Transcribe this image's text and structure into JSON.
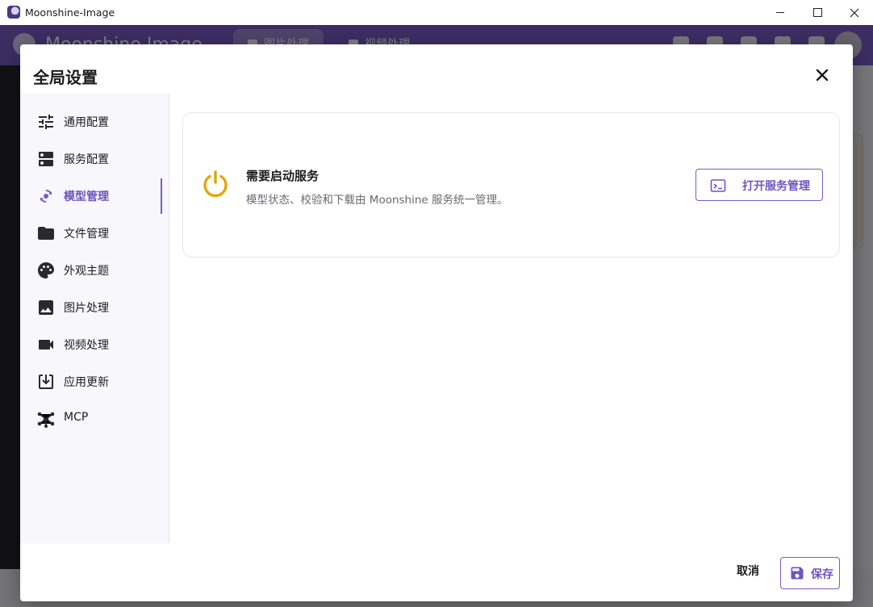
{
  "window": {
    "title": "Moonshine-Image"
  },
  "background_app": {
    "name": "Moonshine Image",
    "tabs": [
      {
        "label": "图片处理"
      },
      {
        "label": "视频处理"
      }
    ]
  },
  "dialog": {
    "title": "全局设置",
    "sidebar": {
      "items": [
        {
          "label": "通用配置",
          "icon": "tune-icon"
        },
        {
          "label": "服务配置",
          "icon": "dns-icon"
        },
        {
          "label": "模型管理",
          "icon": "model-sync-icon",
          "active": true
        },
        {
          "label": "文件管理",
          "icon": "folder-icon"
        },
        {
          "label": "外观主题",
          "icon": "palette-icon"
        },
        {
          "label": "图片处理",
          "icon": "image-icon"
        },
        {
          "label": "视频处理",
          "icon": "videocam-icon"
        },
        {
          "label": "应用更新",
          "icon": "download-box-icon"
        },
        {
          "label": "MCP",
          "icon": "hub-icon"
        }
      ]
    },
    "card": {
      "title": "需要启动服务",
      "description": "模型状态、校验和下载由 Moonshine 服务统一管理。",
      "button_label": "打开服务管理",
      "icon": "power-icon"
    },
    "footer": {
      "cancel_label": "取消",
      "save_label": "保存"
    }
  },
  "colors": {
    "accent": "#7a5bc7",
    "accent_text": "#6e55bf",
    "warning_icon": "#e5a50a",
    "sidebar_bg": "#f8f7fc",
    "header_bg": "#7a5bc7"
  }
}
